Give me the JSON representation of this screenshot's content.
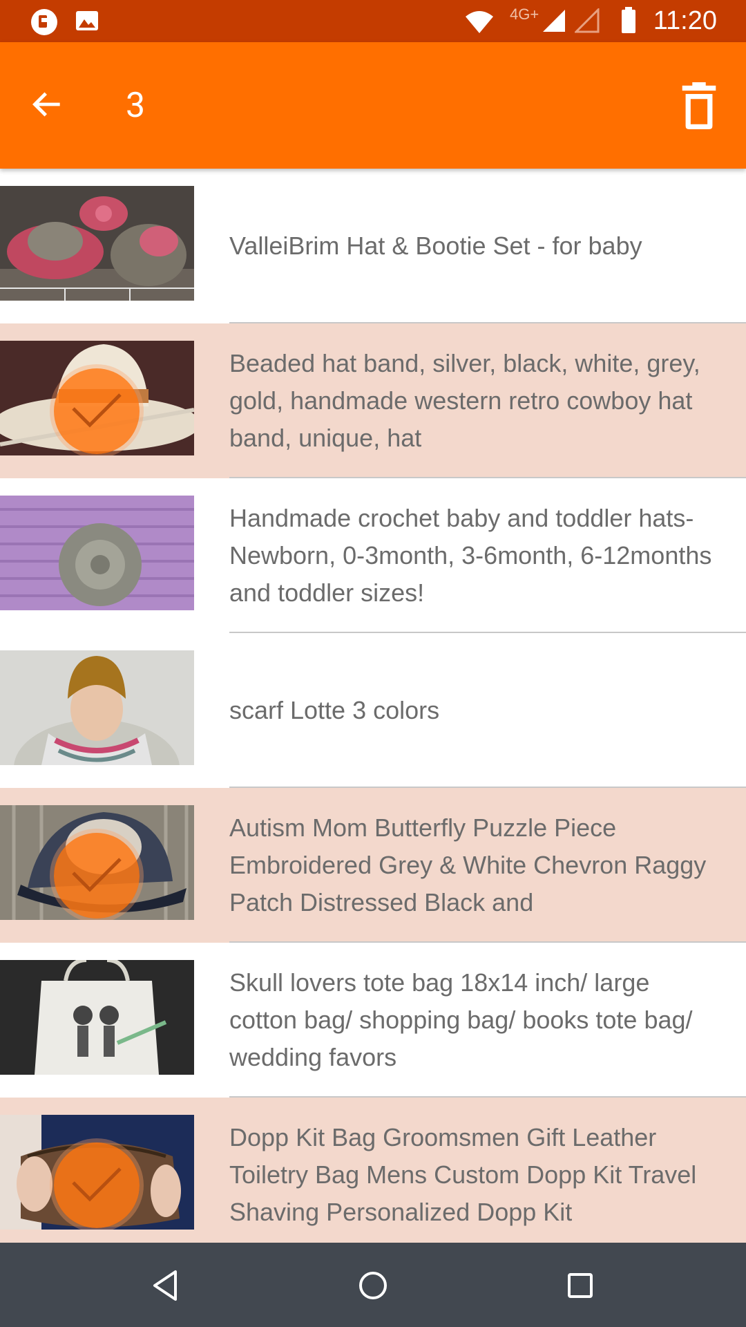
{
  "status_bar": {
    "time": "11:20",
    "network": "4G+"
  },
  "app_bar": {
    "selected_count": "3"
  },
  "items": [
    {
      "title": "ValleiBrim Hat & Bootie Set - for baby",
      "selected": false
    },
    {
      "title": "Beaded hat band, silver, black, white, grey, gold, handmade western retro cowboy hat band, unique, hat",
      "selected": true
    },
    {
      "title": "Handmade crochet baby and toddler hats- Newborn, 0-3month, 3-6month, 6-12months and toddler sizes!",
      "selected": false
    },
    {
      "title": "scarf Lotte 3 colors",
      "selected": false
    },
    {
      "title": "Autism Mom Butterfly Puzzle Piece Embroidered Grey & White Chevron Raggy Patch Distressed Black and",
      "selected": true
    },
    {
      "title": "Skull lovers tote bag 18x14 inch/ large cotton bag/ shopping bag/ books tote bag/ wedding favors",
      "selected": false
    },
    {
      "title": "Dopp Kit Bag Groomsmen Gift Leather Toiletry Bag Mens Custom Dopp Kit Travel Shaving Personalized Dopp Kit",
      "selected": true
    }
  ],
  "colors": {
    "status_bar": "#c43c00",
    "app_bar": "#ff6f00",
    "selected_row": "#f3d8cc",
    "nav_bar": "#424850"
  },
  "icons": {
    "status": [
      "photo-app-icon",
      "image-icon",
      "wifi-icon",
      "signal-icon",
      "battery-icon"
    ],
    "app_bar": [
      "back-arrow-icon",
      "delete-icon"
    ],
    "nav": [
      "nav-back-icon",
      "nav-home-icon",
      "nav-recents-icon"
    ]
  }
}
